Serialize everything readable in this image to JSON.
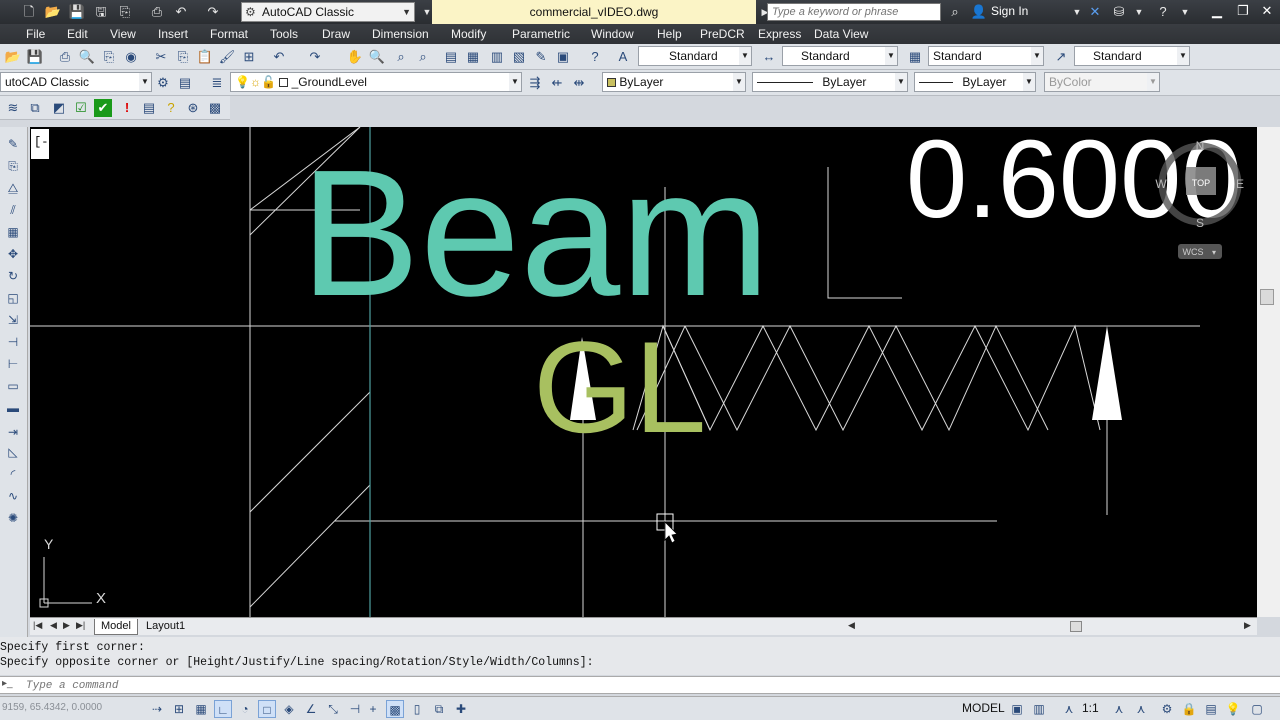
{
  "titlebar": {
    "workspace": "AutoCAD Classic",
    "document_title": "commercial_vIDEO.dwg",
    "search_placeholder": "Type a keyword or phrase",
    "sign_in": "Sign In"
  },
  "menu": [
    "File",
    "Edit",
    "View",
    "Insert",
    "Format",
    "Tools",
    "Draw",
    "Dimension",
    "Modify",
    "Parametric",
    "Window",
    "Help",
    "PreDCR",
    "Express",
    "Data View"
  ],
  "styles_toolbar": {
    "text_style": "Standard",
    "dim_style": "Standard",
    "table_style": "Standard",
    "mleader_style": "Standard"
  },
  "layers_toolbar": {
    "workspace": "utoCAD Classic",
    "layer": "_GroundLevel",
    "color": "ByLayer",
    "linetype": "ByLayer",
    "lineweight": "ByLayer",
    "plotstyle": "ByColor"
  },
  "canvas": {
    "text_beam": "Beam",
    "text_gl": "GL",
    "text_value": "0.6000",
    "viewcube": {
      "north": "N",
      "south": "S",
      "west": "W",
      "east": "E",
      "face": "TOP",
      "ucs": "WCS"
    },
    "ucs_y": "Y",
    "ucs_x": "X",
    "colors": {
      "beam": "#5ec9b0",
      "gl": "#a8c060",
      "value": "#ffffff",
      "lines": "#d8d8d8",
      "cyan_line": "#4fa0a0"
    }
  },
  "tabs": {
    "model": "Model",
    "layout1": "Layout1"
  },
  "command": {
    "history_1": "Specify first corner:",
    "history_2": "Specify opposite corner or [Height/Justify/Line spacing/Rotation/Style/Width/Columns]:",
    "placeholder": "Type a command"
  },
  "status": {
    "coords": "9159, 65.4342, 0.0000",
    "model": "MODEL",
    "scale": "1:1"
  }
}
